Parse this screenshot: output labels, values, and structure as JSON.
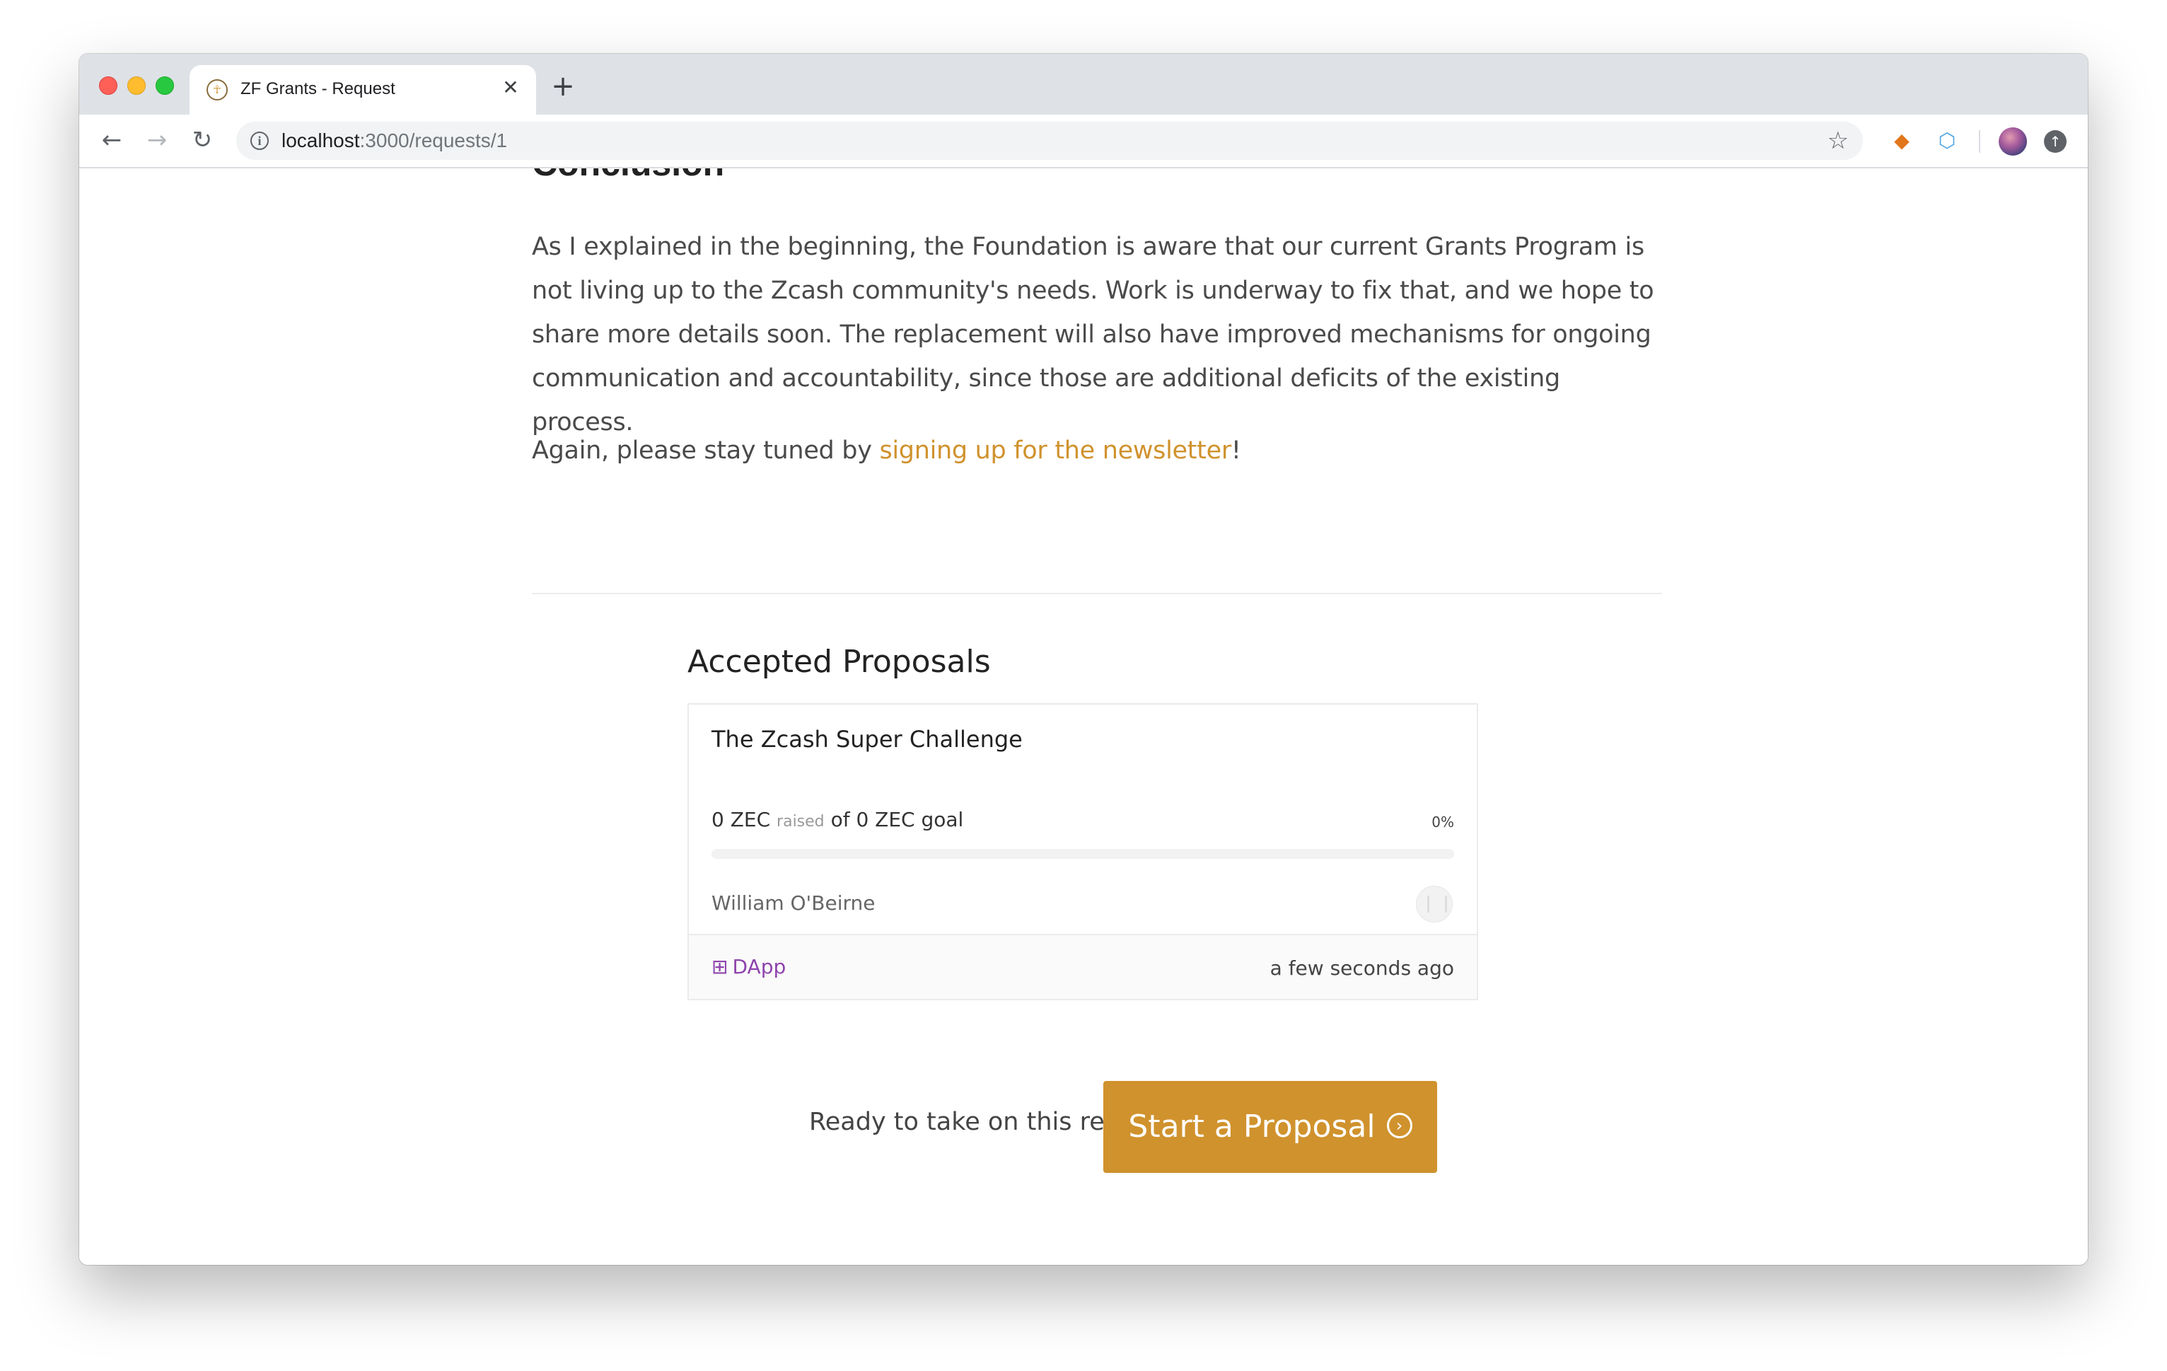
{
  "browser": {
    "tab_title": "ZF Grants - Request",
    "tab_close": "✕",
    "new_tab": "+",
    "url_host": "localhost",
    "url_path": ":3000/requests/1"
  },
  "article": {
    "heading": "Conclusion",
    "paragraph1": "As I explained in the beginning, the Foundation is aware that our current Grants Program is not living up to the Zcash community's needs. Work is underway to fix that, and we hope to share more details soon. The replacement will also have improved mechanisms for ongoing communication and accountability, since those are additional deficits of the existing process.",
    "paragraph2_before": "Again, please stay tuned by ",
    "paragraph2_link": "signing up for the newsletter",
    "paragraph2_after": "!"
  },
  "accepted": {
    "title": "Accepted Proposals",
    "proposals": [
      {
        "title": "The Zcash Super Challenge",
        "raised_amount": "0 ZEC",
        "raised_label": "raised",
        "goal_text": "of 0 ZEC goal",
        "percent_text": "0%",
        "progress": 0,
        "author": "William O'Beirne",
        "category": "DApp",
        "time": "a few seconds ago"
      }
    ]
  },
  "cta": {
    "label": "Ready to take on this request?",
    "button": "Start a Proposal"
  },
  "colors": {
    "accent": "#d0922d",
    "category": "#8e44ad",
    "footer": "#2d2a26"
  }
}
